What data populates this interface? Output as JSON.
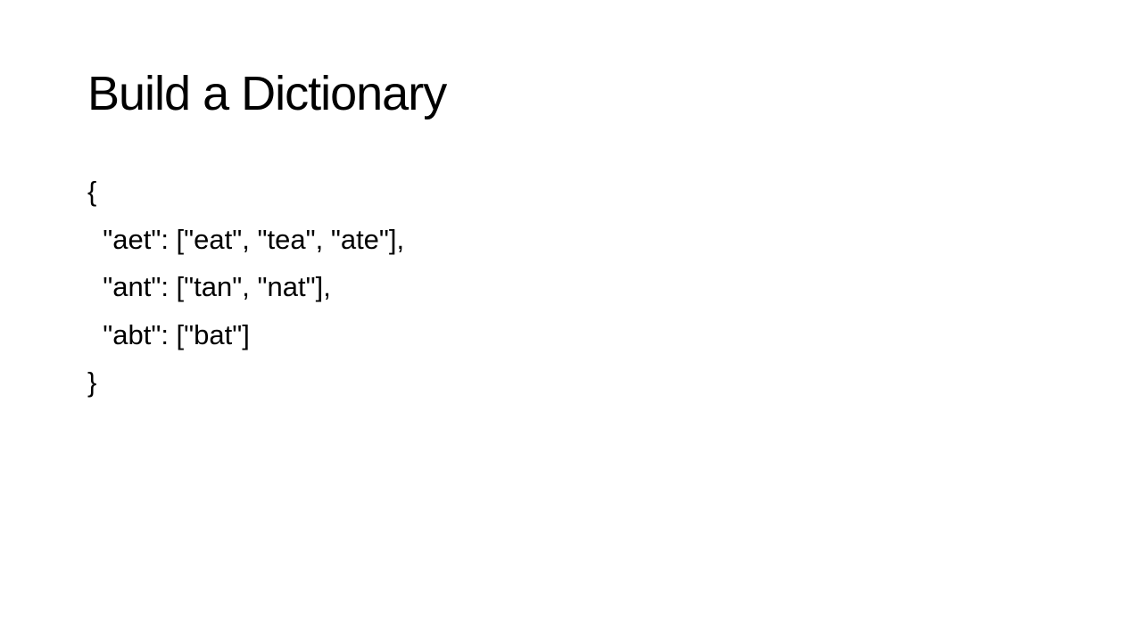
{
  "slide": {
    "title": "Build a Dictionary",
    "lines": [
      "{",
      "  \"aet\": [\"eat\", \"tea\", \"ate\"],",
      "  \"ant\": [\"tan\", \"nat\"],",
      "  \"abt\": [\"bat\"]",
      "}"
    ]
  }
}
